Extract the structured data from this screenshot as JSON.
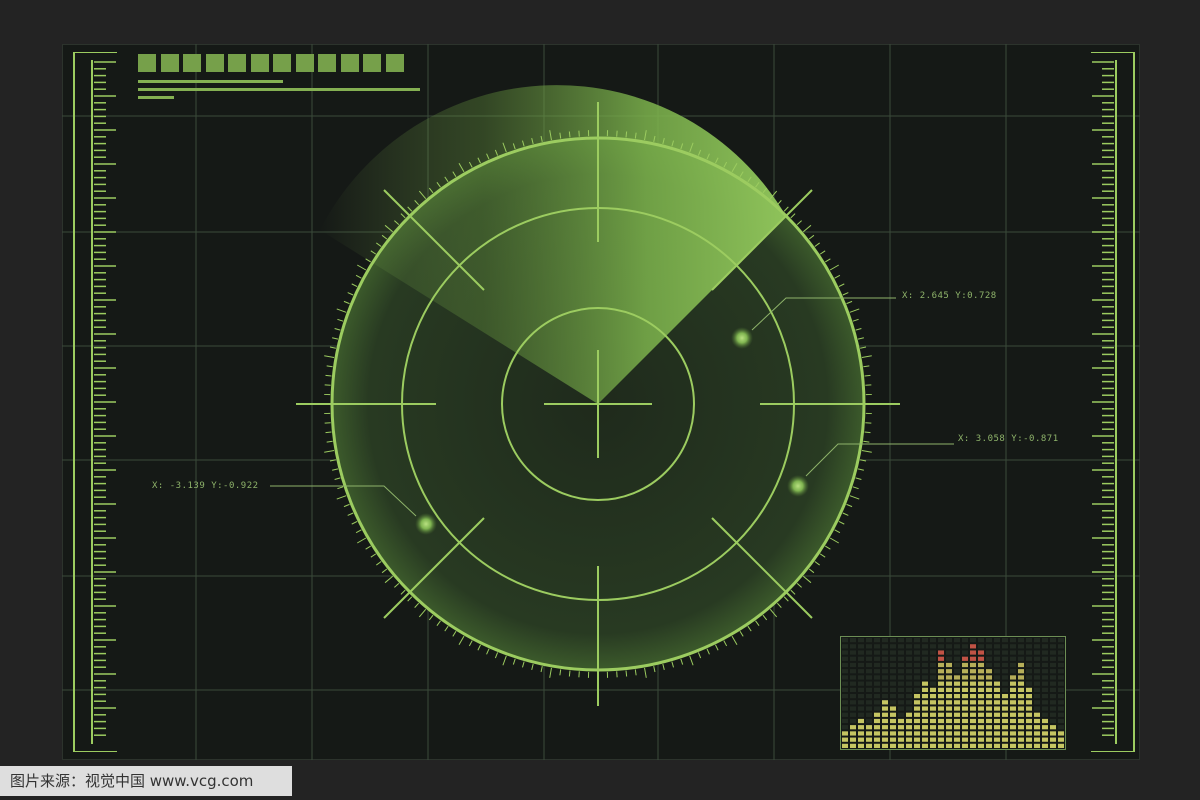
{
  "radar": {
    "blips": [
      {
        "id": "blip-1",
        "x_label": "X: 2.645",
        "y_label": "Y:0.728"
      },
      {
        "id": "blip-2",
        "x_label": "X: 3.058",
        "y_label": "Y:-0.871"
      },
      {
        "id": "blip-3",
        "x_label": "X: -3.139",
        "y_label": "Y:-0.922"
      }
    ]
  },
  "colors": {
    "background": "#232323",
    "screen": "#151916",
    "grid": "#3a4a3a",
    "accent": "#9ccc60",
    "accent_dim": "#6d9a45",
    "sweep": "#8ec25a",
    "eq_yellow": "#d8d86a",
    "eq_red": "#d45a4a"
  },
  "icons": {
    "radar_display": "radar-scope-icon",
    "equalizer": "equalizer-bars-icon"
  },
  "watermark": {
    "text": "图片来源：视觉中国 www.vcg.com"
  }
}
